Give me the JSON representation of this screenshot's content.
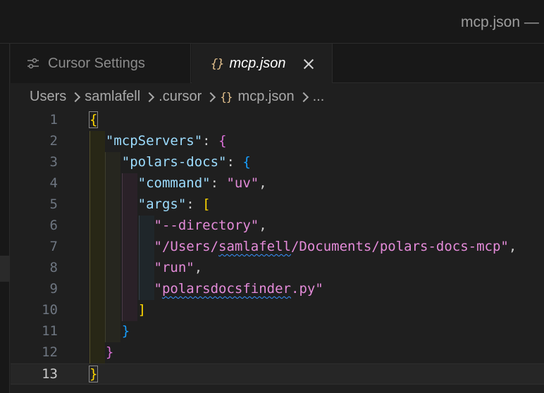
{
  "window": {
    "title": "mcp.json —"
  },
  "tabs": [
    {
      "label": "Cursor Settings",
      "icon": "settings-sliders-icon",
      "active": false
    },
    {
      "label": "mcp.json",
      "icon": "json-braces-icon",
      "icon_glyph": "{}",
      "active": true
    }
  ],
  "breadcrumb": {
    "items": [
      "Users",
      "samlafell",
      ".cursor",
      "mcp.json",
      "..."
    ],
    "file_icon_glyph": "{}"
  },
  "editor": {
    "current_line": 13,
    "line_numbers": [
      "1",
      "2",
      "3",
      "4",
      "5",
      "6",
      "7",
      "8",
      "9",
      "10",
      "11",
      "12",
      "13"
    ],
    "lines": [
      {
        "parts": [
          "{"
        ]
      },
      {
        "parts": [
          "\"mcpServers\"",
          ": ",
          "{"
        ]
      },
      {
        "parts": [
          "\"polars-docs\"",
          ": ",
          "{"
        ]
      },
      {
        "parts": [
          "\"command\"",
          ": ",
          "\"uv\"",
          ","
        ]
      },
      {
        "parts": [
          "\"args\"",
          ": ",
          "["
        ]
      },
      {
        "parts": [
          "\"--directory\"",
          ","
        ]
      },
      {
        "parts": [
          "\"/Users/",
          "samlafell",
          "/Documents/polars-docs-mcp\"",
          ","
        ]
      },
      {
        "parts": [
          "\"run\"",
          ","
        ]
      },
      {
        "parts": [
          "\"",
          "polarsdocsfinder",
          ".py\""
        ]
      },
      {
        "parts": [
          "]"
        ]
      },
      {
        "parts": [
          "}"
        ]
      },
      {
        "parts": [
          "}"
        ]
      },
      {
        "parts": [
          "}"
        ]
      }
    ]
  },
  "colors": {
    "bracket_level1": "#ffd700",
    "bracket_level2": "#da70d6",
    "bracket_level3": "#179fff",
    "json_key": "#9cdcfe",
    "json_string": "#ce9178",
    "spell_squiggle": "#3794ff"
  }
}
